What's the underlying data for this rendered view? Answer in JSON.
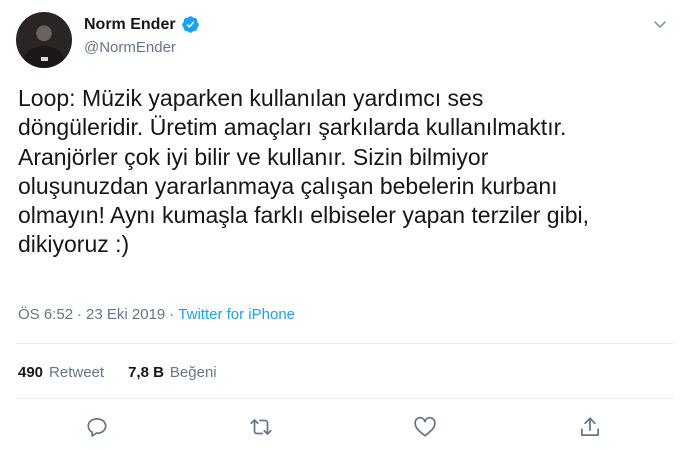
{
  "author": {
    "display_name": "Norm Ender",
    "handle": "@NormEnder",
    "verified_icon": "verified-badge-icon",
    "verified_color": "#1da1f2"
  },
  "tweet": {
    "text": "Loop: Müzik yaparken kullanılan yardımcı ses\ndöngüleridir. Üretim amaçları şarkılarda kullanılmaktır.\nAranjörler çok iyi bilir ve kullanır. Sizin bilmiyor\noluşunuzdan yararlanmaya çalışan bebelerin kurbanı\nolmayın! Aynı kumaşla farklı elbiseler yapan terziler gibi,\ndikiyoruz :)",
    "time": "ÖS 6:52",
    "separator": "·",
    "date": "23 Eki 2019",
    "source": "Twitter for iPhone"
  },
  "stats": {
    "retweets_count": "490",
    "retweets_label": "Retweet",
    "likes_count": "7,8 B",
    "likes_label": "Beğeni"
  },
  "actions": [
    "reply-icon",
    "retweet-icon",
    "like-icon",
    "share-icon"
  ],
  "colors": {
    "text": "#14171a",
    "secondary": "#657786",
    "link": "#1da1f2",
    "divider": "#e6ecf0"
  }
}
